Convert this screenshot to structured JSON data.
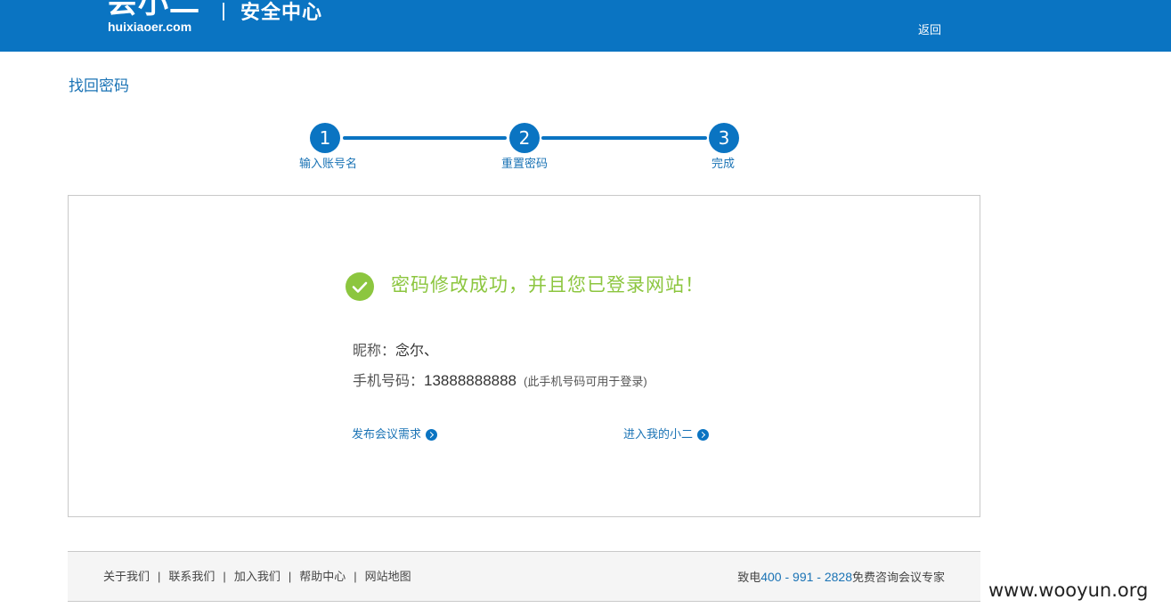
{
  "colors": {
    "brand_blue": "#0a74c2",
    "link_blue": "#1a73b5",
    "success_green": "#8cc63f"
  },
  "header": {
    "logo_text": "会小二",
    "logo_domain": "huixiaoer.com",
    "title": "安全中心",
    "back_label": "返回"
  },
  "page": {
    "title": "找回密码"
  },
  "steps": [
    {
      "number": "1",
      "label": "输入账号名"
    },
    {
      "number": "2",
      "label": "重置密码"
    },
    {
      "number": "3",
      "label": "完成"
    }
  ],
  "result": {
    "icon": "checkmark-icon",
    "message": "密码修改成功，并且您已登录网站！",
    "nickname_label": "昵称：",
    "nickname_value": "念尔、",
    "phone_label": "手机号码：",
    "phone_value": "13888888888",
    "phone_note": "(此手机号码可用于登录)",
    "link_publish": "发布会议需求",
    "link_enter": "进入我的小二",
    "link_icon": "arrow-right-circle-icon"
  },
  "footer": {
    "links": [
      "关于我们",
      "联系我们",
      "加入我们",
      "帮助中心",
      "网站地图"
    ],
    "separator": "|",
    "phone_prefix": "致电",
    "phone_number": "400 - 991 - 2828",
    "phone_suffix": "免费咨询会议专家"
  },
  "watermark": "www.wooyun.org"
}
